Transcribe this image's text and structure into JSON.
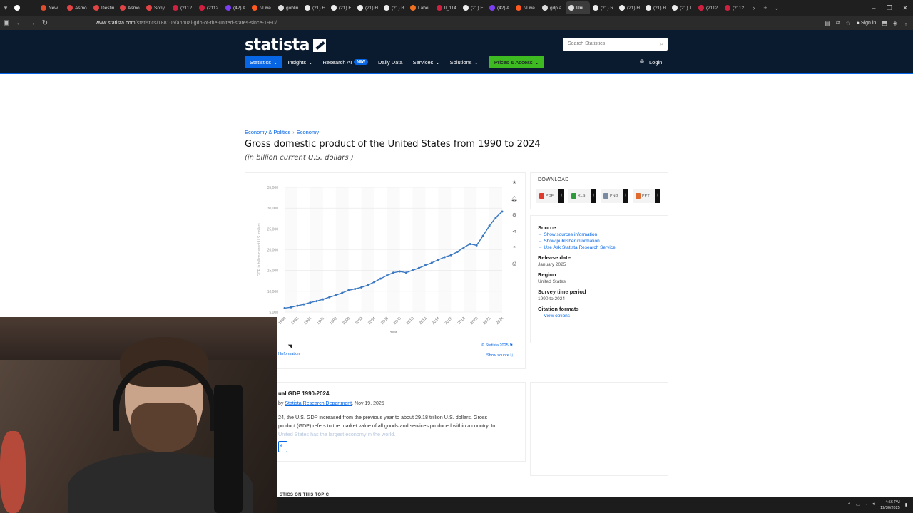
{
  "browser": {
    "tabs": [
      {
        "label": "",
        "color": "#ffffff",
        "active": false
      },
      {
        "label": "New",
        "color": "#e24b2b",
        "active": false
      },
      {
        "label": "Asmo",
        "color": "#e04444",
        "active": false
      },
      {
        "label": "Destin",
        "color": "#e04444",
        "active": false
      },
      {
        "label": "Asmo",
        "color": "#e04444",
        "active": false
      },
      {
        "label": "Sony",
        "color": "#e04444",
        "active": false
      },
      {
        "label": "(2112",
        "color": "#d02040",
        "active": false
      },
      {
        "label": "(2112",
        "color": "#d02040",
        "active": false
      },
      {
        "label": "(42) A",
        "color": "#7a3ff0",
        "active": false
      },
      {
        "label": "r/Live",
        "color": "#ff5a1f",
        "active": false
      },
      {
        "label": "goblin",
        "color": "#dddddd",
        "active": false
      },
      {
        "label": "(21) H",
        "color": "#eeeeee",
        "active": false
      },
      {
        "label": "(21) F",
        "color": "#eeeeee",
        "active": false
      },
      {
        "label": "(21) H",
        "color": "#eeeeee",
        "active": false
      },
      {
        "label": "(21) B",
        "color": "#eeeeee",
        "active": false
      },
      {
        "label": "Label",
        "color": "#f07020",
        "active": false
      },
      {
        "label": "ll_114",
        "color": "#d02040",
        "active": false
      },
      {
        "label": "(21) E",
        "color": "#eeeeee",
        "active": false
      },
      {
        "label": "(42) A",
        "color": "#7a3ff0",
        "active": false
      },
      {
        "label": "r/Live",
        "color": "#ff5a1f",
        "active": false
      },
      {
        "label": "gdp a",
        "color": "#dddddd",
        "active": false
      },
      {
        "label": "Uni",
        "color": "#dddddd",
        "active": true
      },
      {
        "label": "(21) R",
        "color": "#eeeeee",
        "active": false
      },
      {
        "label": "(21) H",
        "color": "#eeeeee",
        "active": false
      },
      {
        "label": "(21) H",
        "color": "#eeeeee",
        "active": false
      },
      {
        "label": "(21) T",
        "color": "#eeeeee",
        "active": false
      },
      {
        "label": "(2112",
        "color": "#d02040",
        "active": false
      },
      {
        "label": "(2112",
        "color": "#d02040",
        "active": false
      }
    ],
    "url_host": "www.statista.com",
    "url_path": "/statistics/188105/annual-gdp-of-the-united-states-since-1990/",
    "sign_in": "Sign in"
  },
  "site": {
    "logo": "statista",
    "search_placeholder": "Search Statistics",
    "nav": [
      {
        "label": "Statistics",
        "chevron": true,
        "style": "stats"
      },
      {
        "label": "Insights",
        "chevron": true,
        "style": ""
      },
      {
        "label": "Research AI",
        "chevron": false,
        "style": "",
        "badge": "NEW"
      },
      {
        "label": "Daily Data",
        "chevron": false,
        "style": ""
      },
      {
        "label": "Services",
        "chevron": true,
        "style": ""
      },
      {
        "label": "Solutions",
        "chevron": true,
        "style": ""
      },
      {
        "label": "Prices & Access",
        "chevron": true,
        "style": "prices"
      }
    ],
    "login": "Login"
  },
  "page": {
    "breadcrumb": [
      "Economy & Politics",
      "Economy"
    ],
    "title": "Gross domestic product of the United States from 1990 to 2024",
    "subtitle": "(in billion current U.S. dollars )"
  },
  "chart_data": {
    "type": "line",
    "title": "",
    "xlabel": "Year",
    "ylabel": "GDP in billion current U.S. dollars",
    "ylim": [
      5000,
      35000
    ],
    "yticks": [
      "5,000",
      "10,000",
      "15,000",
      "20,000",
      "25,000",
      "30,000",
      "35,000"
    ],
    "xticks": [
      "1990",
      "1992",
      "1994",
      "1996",
      "1998",
      "2000",
      "2002",
      "2004",
      "2006",
      "2008",
      "2010",
      "2012",
      "2014",
      "2016",
      "2018",
      "2020",
      "2022",
      "2024"
    ],
    "x": [
      1990,
      1991,
      1992,
      1993,
      1994,
      1995,
      1996,
      1997,
      1998,
      1999,
      2000,
      2001,
      2002,
      2003,
      2004,
      2005,
      2006,
      2007,
      2008,
      2009,
      2010,
      2011,
      2012,
      2013,
      2014,
      2015,
      2016,
      2017,
      2018,
      2019,
      2020,
      2021,
      2022,
      2023,
      2024
    ],
    "series": [
      {
        "values": [
          5960,
          6160,
          6520,
          6860,
          7290,
          7640,
          8070,
          8580,
          9060,
          9630,
          10250,
          10580,
          10940,
          11460,
          12210,
          13040,
          13820,
          14470,
          14770,
          14480,
          15050,
          15600,
          16250,
          16840,
          17550,
          18210,
          18700,
          19480,
          20530,
          21380,
          21060,
          23320,
          25740,
          27720,
          29180
        ]
      }
    ],
    "grid": true,
    "credit": "© Statista 2025",
    "show_source": "Show source",
    "additional_info": "l Information",
    "accent": "#3a78c2"
  },
  "tools": [
    "star-icon",
    "bell-icon",
    "gear-icon",
    "share-icon",
    "quote-icon",
    "print-icon"
  ],
  "download": {
    "title": "DOWNLOAD",
    "buttons": [
      {
        "label": "PDF",
        "color": "#e03a2e"
      },
      {
        "label": "XLS",
        "color": "#2e9a3c"
      },
      {
        "label": "PNG",
        "color": "#7a8aa0"
      },
      {
        "label": "PPT",
        "color": "#e06a2e"
      }
    ]
  },
  "info": {
    "source_label": "Source",
    "source_links": [
      "Show sources information",
      "Show publisher information",
      "Use Ask Statista Research Service"
    ],
    "release_label": "Release date",
    "release_value": "January 2025",
    "region_label": "Region",
    "region_value": "United States",
    "period_label": "Survey time period",
    "period_value": "1990 to 2024",
    "citation_label": "Citation formats",
    "citation_link": "View options"
  },
  "description": {
    "title": "ual GDP 1990-2024",
    "byline_prefix": "by",
    "author": "Statista Research Department",
    "date": ", Nov 19, 2025",
    "line1": "24, the U.S. GDP increased from the previous year to about 29.18 trillion U.S. dollars.  Gross",
    "line2": "product (GDP) refers to the market value of all goods and services produced within a country. In",
    "line3": " United States has the largest economy in the world.",
    "read_more": "e"
  },
  "next_heading": "STICS ON THIS TOPIC",
  "taskbar": {
    "time": "4:56 PM",
    "date": "12/30/2025"
  }
}
